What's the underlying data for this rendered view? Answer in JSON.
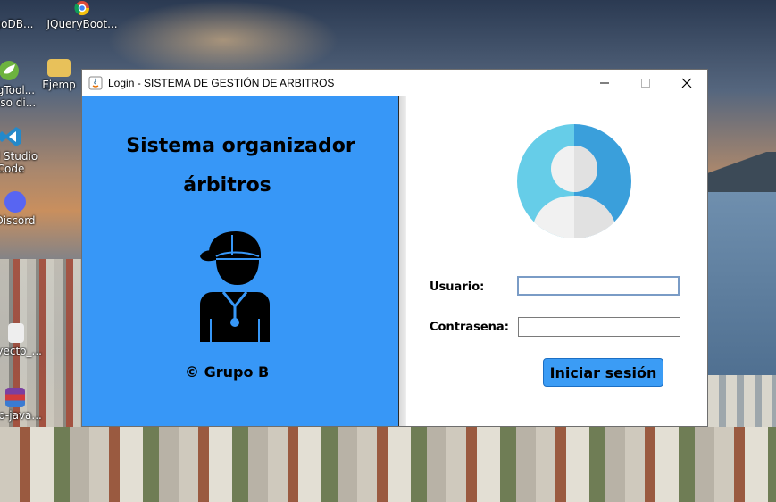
{
  "desktop": {
    "icons": [
      {
        "label": "ongoDB...",
        "icon": "mongodb-icon"
      },
      {
        "label": "JQueryBoot...",
        "icon": "chrome-icon"
      },
      {
        "label": "ringTool...",
        "icon": "spring-tool-icon",
        "label2": "cceso di..."
      },
      {
        "label": "Ejemp",
        "icon": "folder-icon"
      },
      {
        "label": "ual Studio",
        "icon": "vscode-icon",
        "label2": "Code"
      },
      {
        "label": "Discord",
        "icon": "discord-icon"
      },
      {
        "label": "oyecto_...",
        "icon": "project-icon"
      },
      {
        "label": "rso-java...",
        "icon": "winrar-icon"
      }
    ]
  },
  "window": {
    "title": "Login - SISTEMA DE GESTIÓN DE ARBITROS",
    "app_icon": "java-icon",
    "controls": {
      "minimize": "minimize-icon",
      "maximize": "maximize-icon",
      "close": "close-icon"
    }
  },
  "left_panel": {
    "title_line1": "Sistema organizador",
    "title_line2": "árbitros",
    "illustration": "referee-icon",
    "footer": "© Grupo B",
    "background": "#3797f7"
  },
  "right_panel": {
    "avatar": "user-avatar-icon",
    "username_label": "Usuario:",
    "username_value": "",
    "password_label": "Contraseña:",
    "password_value": "",
    "login_button": "Iniciar sesión",
    "button_color": "#3b9cf5"
  }
}
